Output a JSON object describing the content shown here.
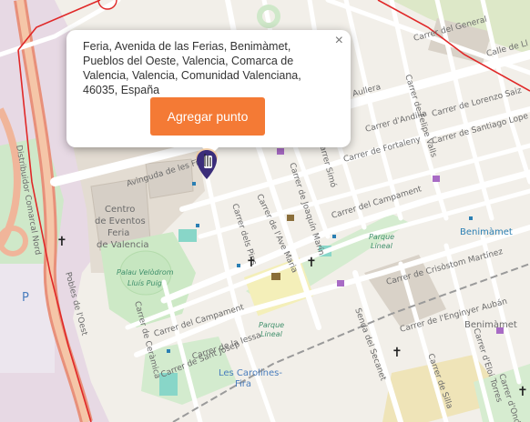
{
  "popup": {
    "address": "Feria, Avenida de las Ferias, Benimàmet, Pueblos del Oeste, Valencia, Comarca de Valencia, Valencia, Comunidad Valenciana, 46035, España",
    "close_symbol": "×",
    "add_point_label": "Agregar punto"
  },
  "map": {
    "streets": {
      "av_ferias": "Avinguda de les Fires",
      "carrer_pins": "Carrer dels Pins",
      "carrer_ave_maria": "Carrer de l'Ave Maria",
      "joaquin_marin": "Carrer de Joaquín Marín",
      "felipe_valls": "Carrer de Felipe Valls",
      "del_general": "Carrer del General",
      "carrer_andilla": "Carrer d'Andilla",
      "carrer_fortaleny": "Carrer de Fortaleny",
      "carrer_campament_1": "Carrer del Campament",
      "carrer_campament_2": "Carrer del Campament",
      "lorenzo_saiz": "Carrer de Lorenzo Saiz",
      "santiago_lope": "Carrer de Santiago Lope",
      "crisostom": "Carrer de Crisòstom Martínez",
      "enginyer": "Carrer de l'Enginyer Aubán",
      "carrer_ceramica": "Carrer de Ceràmica",
      "carrer_iessa": "Carrer de la Iessa",
      "sant_josep": "Carrer de Sant Josep",
      "senda_secanet": "Senda del Secanet",
      "carrer_silla": "Carrer de Silla",
      "eloi_torres": "Carrer d'Eloi Torres",
      "carrer_onda": "Carrer d'Onda",
      "carrer_simo": "Carrer Simó",
      "callejo": "Calle de Ll",
      "distribuidor": "Distribuidor Comarcal Nord",
      "pobles_oest": "Pobles de l'Oest",
      "aullera": "Aullera"
    },
    "places": {
      "centro_eventos": [
        "Centro",
        "de Eventos",
        "Feria",
        "de Valencia"
      ],
      "velodrom": [
        "Palau Velòdrom",
        "Lluís Puig"
      ],
      "parque_lineal_1": [
        "Parque",
        "Lineal"
      ],
      "parque_lineal_2": [
        "Parque",
        "Lineal"
      ],
      "benimamet_station": "Benimàmet",
      "benimamet_area": "Benimàmet",
      "carolines": [
        "Les Carolines-",
        "Fira"
      ],
      "parking": "P"
    }
  }
}
